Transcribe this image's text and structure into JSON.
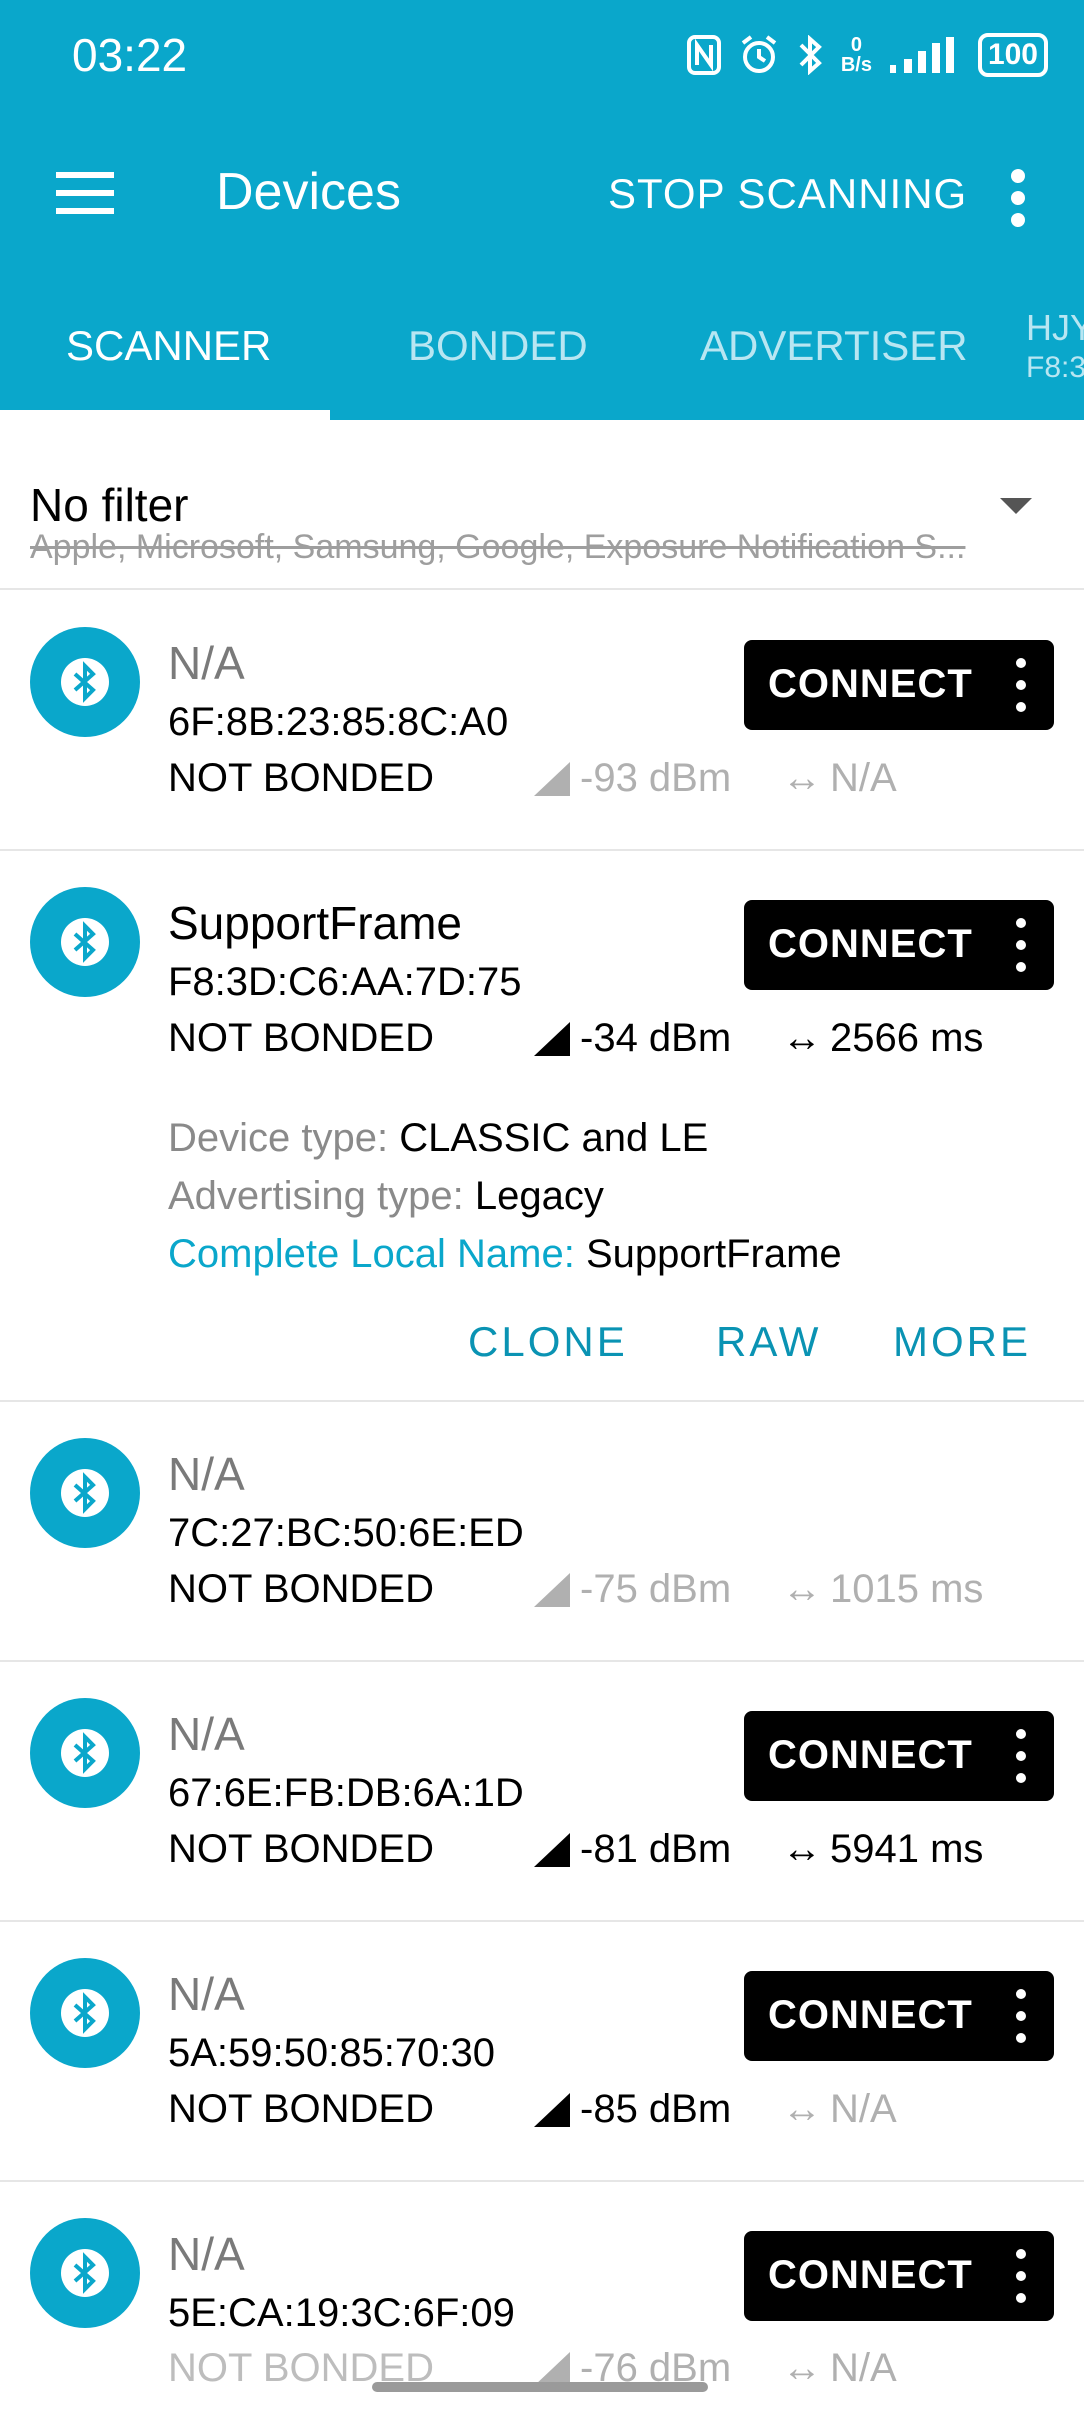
{
  "status": {
    "time": "03:22",
    "net_speed_top": "0",
    "net_speed_bottom": "B/s",
    "battery": "100"
  },
  "appbar": {
    "title": "Devices",
    "stop_label": "STOP SCANNING"
  },
  "tabs": [
    {
      "label": "SCANNER"
    },
    {
      "label": "BONDED"
    },
    {
      "label": "ADVERTISER"
    },
    {
      "label": "HJY",
      "sub": "F8:3"
    }
  ],
  "filter": {
    "title": "No filter",
    "subtitle": "Apple, Microsoft, Samsung, Google, Exposure Notification S..."
  },
  "devices": [
    {
      "name": "N/A",
      "address": "6F:8B:23:85:8C:A0",
      "bond": "NOT BONDED",
      "rssi": "-93 dBm",
      "interval": "N/A",
      "connect": "CONNECT"
    },
    {
      "name": "SupportFrame",
      "address": "F8:3D:C6:AA:7D:75",
      "bond": "NOT BONDED",
      "rssi": "-34 dBm",
      "interval": "2566 ms",
      "connect": "CONNECT",
      "details": {
        "device_type_label": "Device type:",
        "device_type": "CLASSIC and LE",
        "adv_type_label": "Advertising type:",
        "adv_type": "Legacy",
        "local_name_label": "Complete Local Name:",
        "local_name": "SupportFrame"
      },
      "actions": {
        "clone": "CLONE",
        "raw": "RAW",
        "more": "MORE"
      }
    },
    {
      "name": "N/A",
      "address": "7C:27:BC:50:6E:ED",
      "bond": "NOT BONDED",
      "rssi": "-75 dBm",
      "interval": "1015 ms"
    },
    {
      "name": "N/A",
      "address": "67:6E:FB:DB:6A:1D",
      "bond": "NOT BONDED",
      "rssi": "-81 dBm",
      "interval": "5941 ms",
      "connect": "CONNECT"
    },
    {
      "name": "N/A",
      "address": "5A:59:50:85:70:30",
      "bond": "NOT BONDED",
      "rssi": "-85 dBm",
      "interval": "N/A",
      "connect": "CONNECT"
    },
    {
      "name": "N/A",
      "address": "5E:CA:19:3C:6F:09",
      "bond": "NOT BONDED",
      "rssi": "-76 dBm",
      "interval": "N/A",
      "connect": "CONNECT"
    }
  ],
  "colors": {
    "accent": "#0aa7cb",
    "button": "#000000"
  }
}
